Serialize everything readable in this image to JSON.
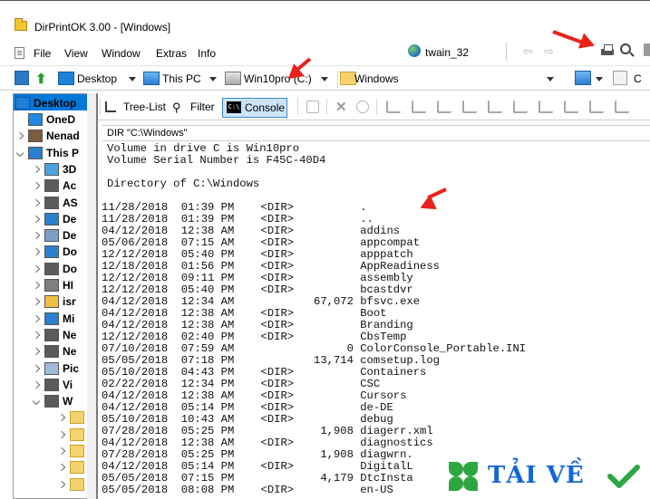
{
  "window": {
    "title": "DirPrintOK 3.00 - [Windows]"
  },
  "menu": {
    "items": [
      "File",
      "View",
      "Window",
      "Extras",
      "Info"
    ]
  },
  "toolbar": {
    "twain_label": "twain_32"
  },
  "address": {
    "desktop": "Desktop",
    "this_pc": "This PC",
    "drive": "Win10pro (C:)",
    "folder": "Windows",
    "right_partial": "C"
  },
  "tree": {
    "root": "Desktop",
    "items": [
      "OneD",
      "Nenad",
      "This P",
      "3D",
      "Ac",
      "AS",
      "De",
      "De",
      "Do",
      "Do",
      "HI",
      "isr",
      "Mi",
      "Ne",
      "Ne",
      "Pic",
      "Vi",
      "W"
    ]
  },
  "tabs": {
    "tree_list": "Tree-List",
    "filter": "Filter",
    "console": "Console",
    "console_icon_text": "C:\\"
  },
  "path_command": "DIR \"C:\\Windows\"",
  "console": {
    "lines": [
      "Volume in drive C is Win10pro",
      "Volume Serial Number is F45C-40D4",
      "",
      "Directory of C:\\Windows",
      "",
      "11/28/2018  01:39 PM    <DIR>          .",
      "11/28/2018  01:39 PM    <DIR>          ..",
      "04/12/2018  12:38 AM    <DIR>          addins",
      "05/06/2018  07:15 AM    <DIR>          appcompat",
      "12/12/2018  05:40 PM    <DIR>          apppatch",
      "12/18/2018  01:56 PM    <DIR>          AppReadiness",
      "12/12/2018  09:11 PM    <DIR>          assembly",
      "12/12/2018  05:40 PM    <DIR>          bcastdvr",
      "04/12/2018  12:34 AM            67,072 bfsvc.exe",
      "04/12/2018  12:38 AM    <DIR>          Boot",
      "04/12/2018  12:38 AM    <DIR>          Branding",
      "12/12/2018  02:40 PM    <DIR>          CbsTemp",
      "07/10/2018  07:59 AM                 0 ColorConsole_Portable.INI",
      "05/05/2018  07:18 PM            13,714 comsetup.log",
      "05/10/2018  04:43 PM    <DIR>          Containers",
      "02/22/2018  12:34 PM    <DIR>          CSC",
      "04/12/2018  12:38 AM    <DIR>          Cursors",
      "04/12/2018  05:14 PM    <DIR>          de-DE",
      "05/10/2018  10:43 AM    <DIR>          debug",
      "07/28/2018  05:25 PM             1,908 diagerr.xml",
      "04/12/2018  12:38 AM    <DIR>          diagnostics",
      "07/28/2018  05:25 PM             1,908 diagwrn.",
      "04/12/2018  05:14 PM    <DIR>          DigitalL",
      "05/05/2018  07:15 PM             4,179 DtcInsta",
      "05/05/2018  08:08 PM    <DIR>          en-US"
    ]
  },
  "watermark": {
    "text": "TẢI VỀ"
  },
  "colors": {
    "selection": "#0078d7",
    "arrow": "#e8231b",
    "watermark": "#1266d8",
    "clover": "#2da73f"
  }
}
